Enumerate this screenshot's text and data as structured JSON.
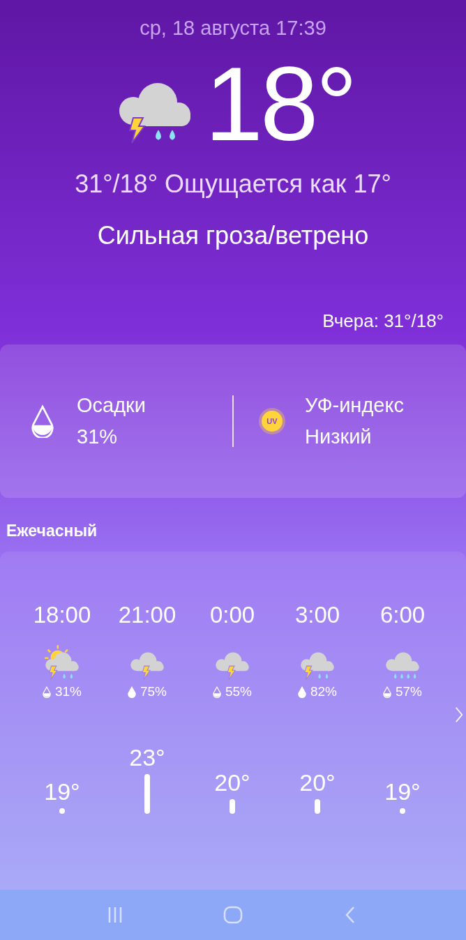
{
  "header": {
    "datetime": "ср, 18 августа 17:39"
  },
  "current": {
    "kind": "storm-rain",
    "temp": "18°",
    "range_feels": "31°/18° Ощущается как 17°",
    "condition": "Сильная гроза/ветрено",
    "yesterday": "Вчера: 31°/18°"
  },
  "details": [
    {
      "kind": "precip",
      "label": "Осадки",
      "value": "31%"
    },
    {
      "kind": "uv",
      "label": "УФ-индекс",
      "value": "Низкий",
      "badge": "UV"
    }
  ],
  "hourly": {
    "title": "Ежечасный",
    "items": [
      {
        "time": "18:00",
        "kind": "sun-storm-rain",
        "drop_full": false,
        "precip": "31%",
        "temp": "19°"
      },
      {
        "time": "21:00",
        "kind": "storm",
        "drop_full": true,
        "precip": "75%",
        "temp": "23°"
      },
      {
        "time": "0:00",
        "kind": "storm",
        "drop_full": false,
        "precip": "55%",
        "temp": "20°"
      },
      {
        "time": "3:00",
        "kind": "storm-rain",
        "drop_full": true,
        "precip": "82%",
        "temp": "20°"
      },
      {
        "time": "6:00",
        "kind": "rain",
        "drop_full": false,
        "precip": "57%",
        "temp": "19°"
      }
    ]
  }
}
